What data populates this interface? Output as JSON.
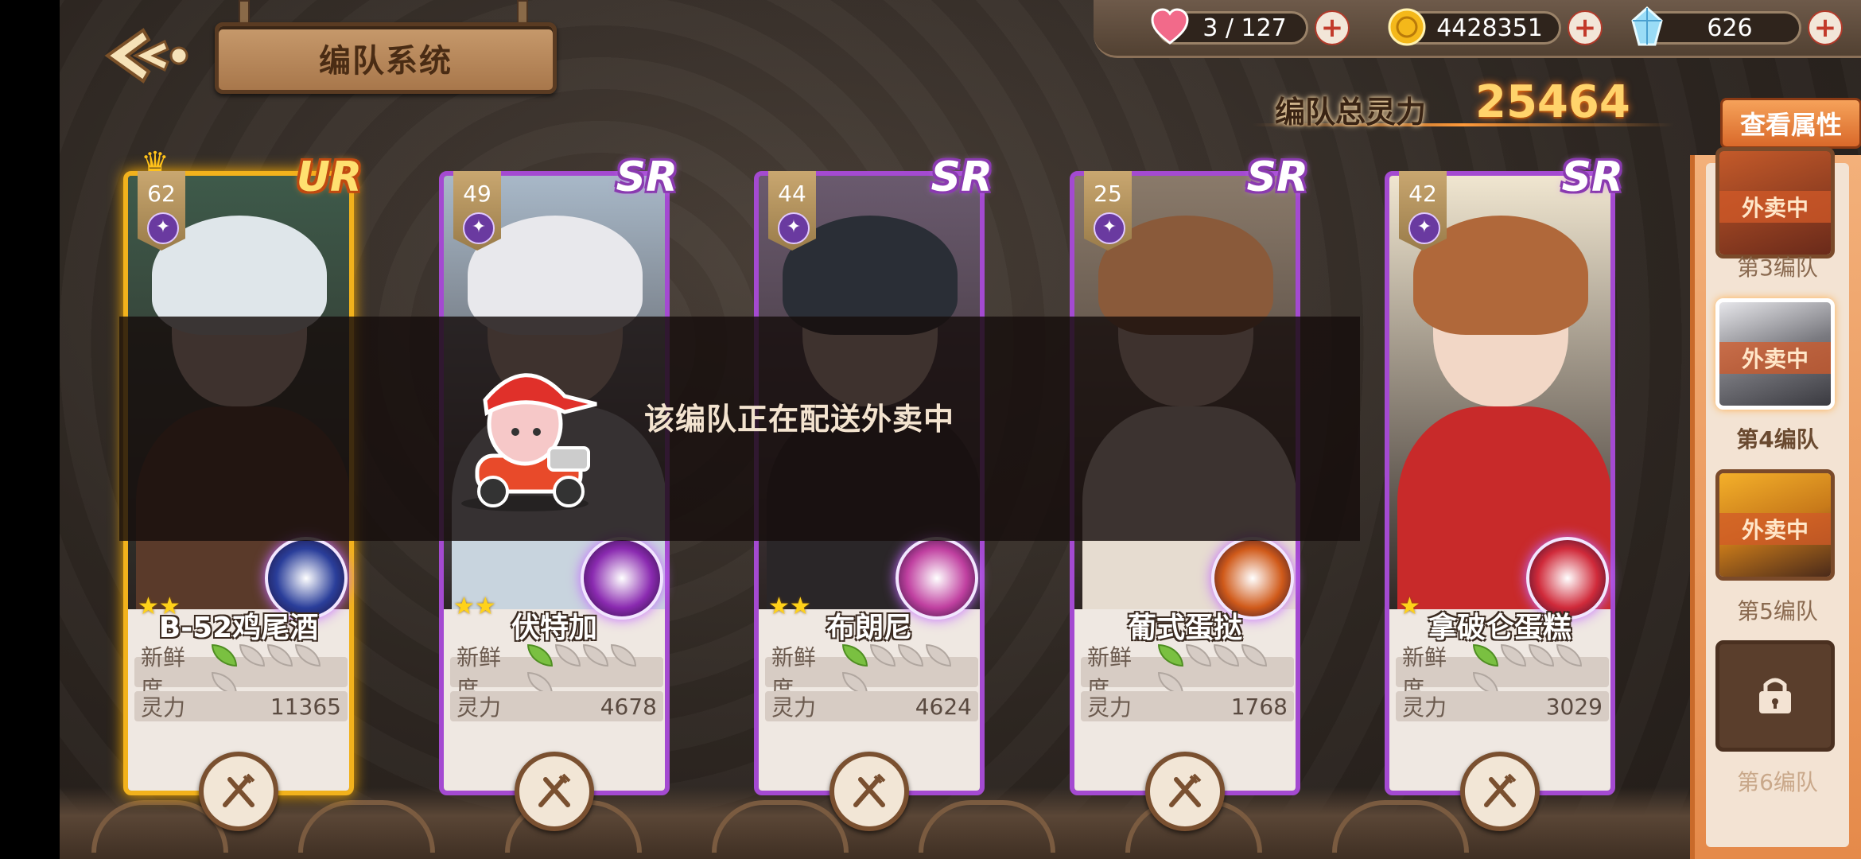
{
  "header": {
    "title": "编队系统",
    "back_icon": "back-arrow-icon"
  },
  "resources": [
    {
      "name": "stamina",
      "icon": "heart-icon",
      "value": "3 / 127"
    },
    {
      "name": "gold",
      "icon": "gold-coin-icon",
      "value": "4428351"
    },
    {
      "name": "crystal",
      "icon": "crystal-icon",
      "value": "626"
    }
  ],
  "power": {
    "label": "编队总灵力",
    "value": "25464"
  },
  "view_attributes_button": "查看属性",
  "overlay": {
    "message": "该编队正在配送外卖中"
  },
  "cards": [
    {
      "name": "B-52鸡尾酒",
      "level": "62",
      "rarity": "UR",
      "stars": "★★",
      "freshness_label": "新鲜度",
      "freshness": 1,
      "power_label": "灵力",
      "power": "11365",
      "leader": true,
      "colors": {
        "hair": "#dfe6ea",
        "body": "#5a3a2a",
        "bg": "#3e5a4a",
        "skill": "#2a3e9a"
      }
    },
    {
      "name": "伏特加",
      "level": "49",
      "rarity": "SR",
      "stars": "★★",
      "freshness_label": "新鲜度",
      "freshness": 1,
      "power_label": "灵力",
      "power": "4678",
      "leader": false,
      "colors": {
        "hair": "#e8e8ec",
        "body": "#c8d4de",
        "bg": "#a8b8c8",
        "skill": "#8a2ab0"
      }
    },
    {
      "name": "布朗尼",
      "level": "44",
      "rarity": "SR",
      "stars": "★★",
      "freshness_label": "新鲜度",
      "freshness": 1,
      "power_label": "灵力",
      "power": "4624",
      "leader": false,
      "colors": {
        "hair": "#2a2e36",
        "body": "#2a2628",
        "bg": "#6a5a6e",
        "skill": "#c040a0"
      }
    },
    {
      "name": "葡式蛋挞",
      "level": "25",
      "rarity": "SR",
      "stars": "",
      "freshness_label": "新鲜度",
      "freshness": 1,
      "power_label": "灵力",
      "power": "1768",
      "leader": false,
      "colors": {
        "hair": "#8a5a3a",
        "body": "#e6dcd0",
        "bg": "#8a7a6a",
        "skill": "#d05a1a"
      }
    },
    {
      "name": "拿破仑蛋糕",
      "level": "42",
      "rarity": "SR",
      "stars": "★",
      "freshness_label": "新鲜度",
      "freshness": 1,
      "power_label": "灵力",
      "power": "3029",
      "leader": false,
      "colors": {
        "hair": "#b0683a",
        "body": "#c82a2a",
        "bg": "#f0e6d0",
        "skill": "#d02a3a"
      }
    }
  ],
  "teams": [
    {
      "label": "第3编队",
      "status": "外卖中",
      "selected": false
    },
    {
      "label": "第4编队",
      "status": "外卖中",
      "selected": true
    },
    {
      "label": "第5编队",
      "status": "外卖中",
      "selected": false
    },
    {
      "label": "第6编队",
      "status": "",
      "locked": true,
      "selected": false
    }
  ]
}
